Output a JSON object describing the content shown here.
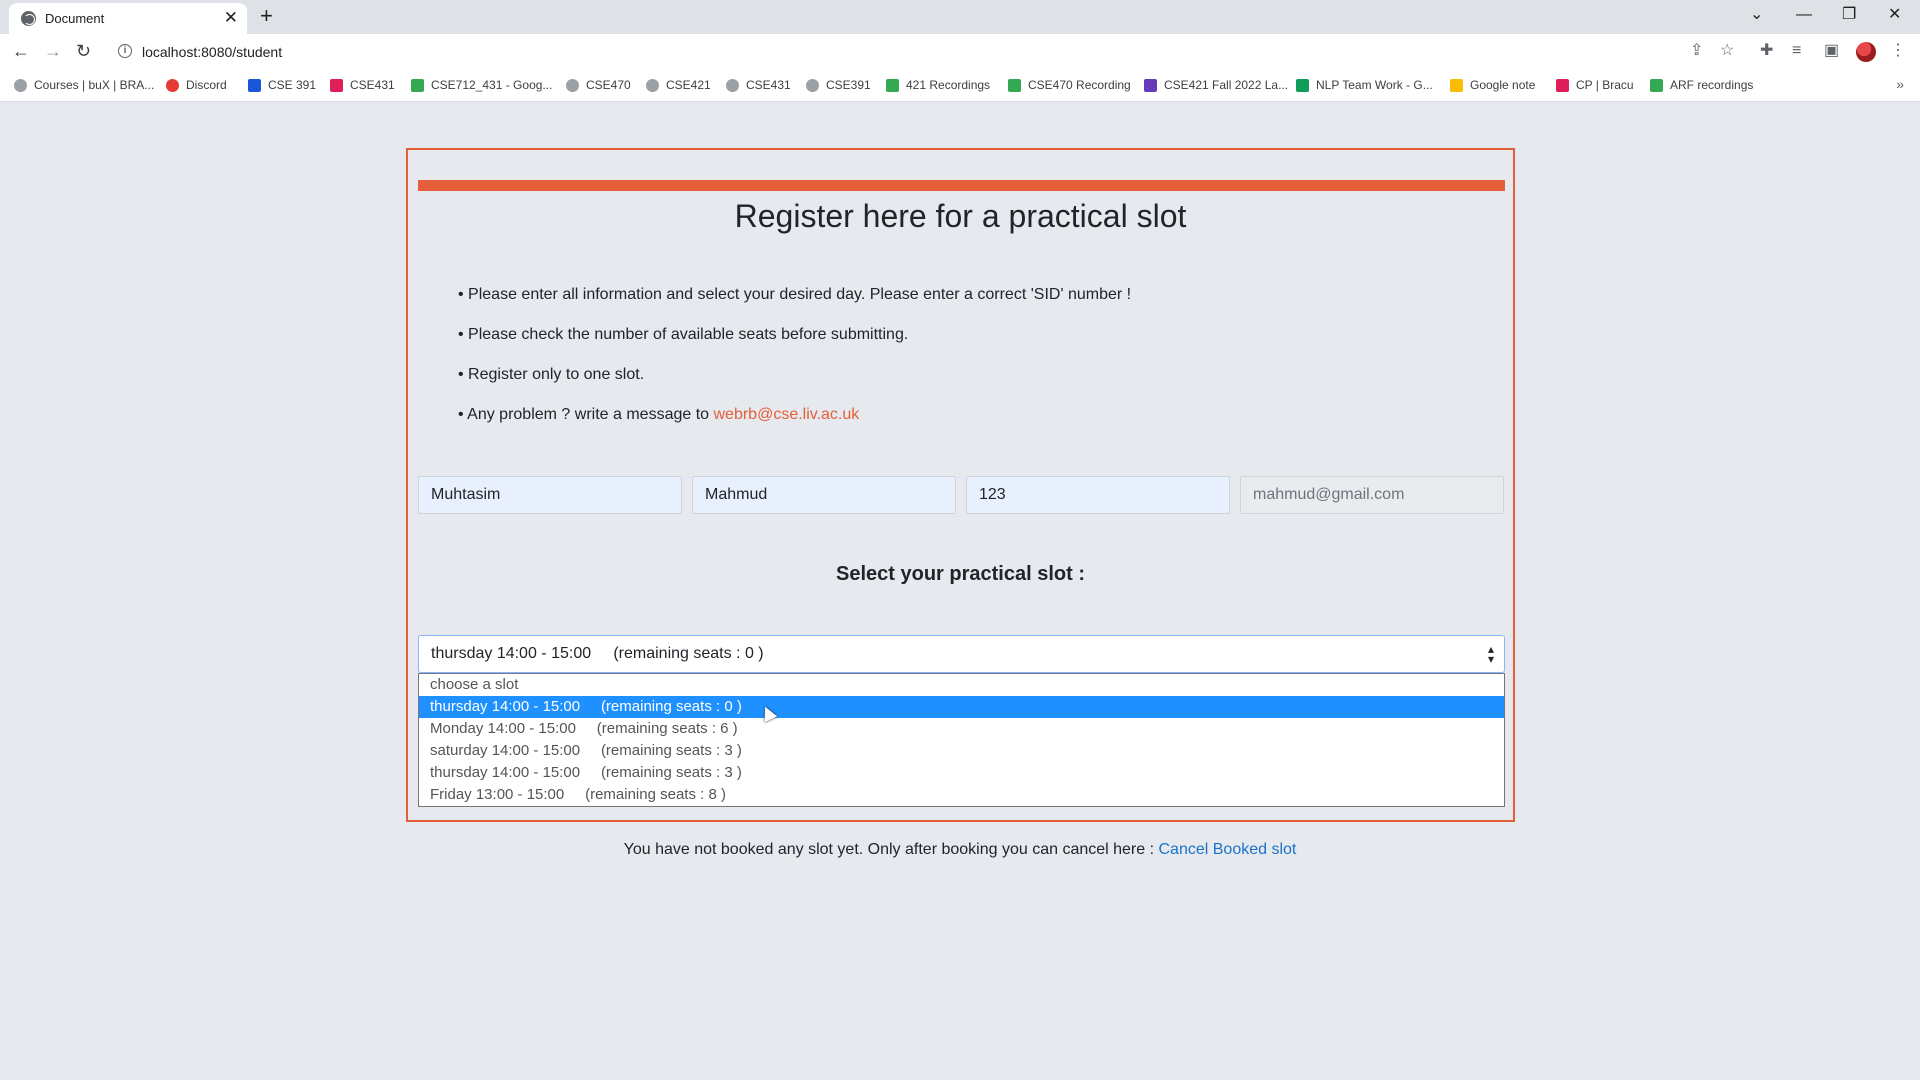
{
  "browser": {
    "tab_title": "Document",
    "url": "localhost:8080/student",
    "bookmarks": [
      {
        "label": "Courses | buX | BRA...",
        "icon": "globe-icon",
        "color": "#9aa0a6"
      },
      {
        "label": "Discord",
        "icon": "discord-icon",
        "color": "#e53935"
      },
      {
        "label": "CSE 391",
        "icon": "p-icon",
        "color": "#1a56db"
      },
      {
        "label": "CSE431",
        "icon": "slack-icon",
        "color": "#e01e5a"
      },
      {
        "label": "CSE712_431 - Goog...",
        "icon": "drive-icon",
        "color": "#34a853"
      },
      {
        "label": "CSE470",
        "icon": "globe-icon",
        "color": "#9aa0a6"
      },
      {
        "label": "CSE421",
        "icon": "globe-icon",
        "color": "#9aa0a6"
      },
      {
        "label": "CSE431",
        "icon": "globe-icon",
        "color": "#9aa0a6"
      },
      {
        "label": "CSE391",
        "icon": "globe-icon",
        "color": "#9aa0a6"
      },
      {
        "label": "421 Recordings",
        "icon": "drive-icon",
        "color": "#34a853"
      },
      {
        "label": "CSE470 Recording",
        "icon": "drive-icon",
        "color": "#34a853"
      },
      {
        "label": "CSE421 Fall 2022 La...",
        "icon": "forms-icon",
        "color": "#673ab7"
      },
      {
        "label": "NLP Team Work - G...",
        "icon": "sheets-icon",
        "color": "#0f9d58"
      },
      {
        "label": "Google note",
        "icon": "keep-icon",
        "color": "#fbbc04"
      },
      {
        "label": "CP | Bracu",
        "icon": "slack-icon",
        "color": "#e01e5a"
      },
      {
        "label": "ARF recordings",
        "icon": "drive-icon",
        "color": "#34a853"
      }
    ]
  },
  "page": {
    "title": "Register here for a practical slot",
    "instructions": [
      "• Please enter all information and select your desired day. Please enter a correct 'SID' number !",
      "• Please check the number of available seats before submitting.",
      "• Register only to one slot.",
      "• Any problem ? write a message to "
    ],
    "contact_email": "webrb@cse.liv.ac.uk",
    "fields": {
      "first_name": "Muhtasim",
      "last_name": "Mahmud",
      "sid": "123",
      "email": "mahmud@gmail.com"
    },
    "select_label": "Select your practical slot :",
    "selected_value": "thursday 14:00 - 15:00     (remaining seats : 0 )",
    "options": [
      "choose a slot",
      "thursday 14:00 - 15:00     (remaining seats : 0 )",
      "Monday 14:00 - 15:00     (remaining seats : 6 )",
      "saturday 14:00 - 15:00     (remaining seats : 3 )",
      "thursday 14:00 - 15:00     (remaining seats : 3 )",
      "Friday 13:00 - 15:00     (remaining seats : 8 )"
    ],
    "highlighted_option_index": 1,
    "footer_text": "You have not booked any slot yet. Only after booking you can cancel here : ",
    "footer_link": "Cancel Booked slot"
  },
  "colors": {
    "accent": "#e45f3a",
    "highlight": "#1e90ff",
    "link": "#1a73c9"
  }
}
